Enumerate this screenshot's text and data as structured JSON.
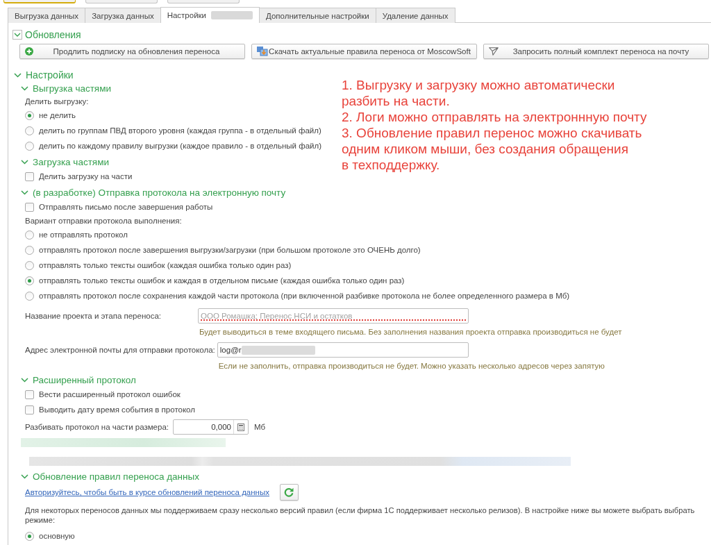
{
  "toolbar_edges": [
    {
      "kind": "accent"
    },
    {
      "kind": "plain"
    },
    {
      "kind": "plain"
    }
  ],
  "tabs": [
    {
      "label": "Выгрузка данных",
      "selected": false,
      "redacted_suffix": false
    },
    {
      "label": "Загрузка данных",
      "selected": false,
      "redacted_suffix": false
    },
    {
      "label": "Настройки",
      "selected": true,
      "redacted_suffix": true
    },
    {
      "label": "Дополнительные настройки",
      "selected": false,
      "redacted_suffix": false
    },
    {
      "label": "Удаление данных",
      "selected": false,
      "redacted_suffix": false
    }
  ],
  "updates_group": {
    "title": "Обновления",
    "expanded": true,
    "buttons": [
      {
        "label": "Продлить подписку на обновления переноса"
      },
      {
        "label": "Скачать актуальные правила переноса от MoscowSoft"
      },
      {
        "label": "Запросить полный комплект переноса на почту"
      }
    ]
  },
  "settings_group": {
    "title": "Настройки",
    "expanded": true,
    "sections": [
      {
        "title": "Выгрузка частями",
        "expanded": true,
        "items": [
          {
            "kind": "radios",
            "label": "Делить выгрузку:",
            "options": [
              {
                "label": "не делить",
                "selected": true
              },
              {
                "label": "делить по группам ПВД второго уровня (каждая группа - в отдельный файл)",
                "selected": false
              },
              {
                "label": "делить по каждому правилу выгрузки (каждое правило - в отдельный файл)",
                "selected": false
              }
            ]
          }
        ]
      },
      {
        "title": "Загрузка частями",
        "expanded": true,
        "items": [
          {
            "kind": "checkbox",
            "label": "Делить загрузку на части",
            "checked": false
          }
        ]
      },
      {
        "title": "(в разработке) Отправка протокола на электронную почту",
        "expanded": true,
        "items": [
          {
            "kind": "checkbox",
            "label": "Отправлять письмо после завершения работы",
            "checked": false
          },
          {
            "kind": "radios",
            "label": "Вариант отправки протокола выполнения:",
            "options": [
              {
                "label": "не отправлять протокол",
                "selected": false
              },
              {
                "label": "отправлять протокол после завершения выгрузки/загрузки (при большом протоколе это ОЧЕНЬ долго)",
                "selected": false
              },
              {
                "label": "отправлять только тексты ошибок (каждая ошибка только один раз)",
                "selected": false
              },
              {
                "label": "отправлять только тексты ошибок и каждая в отдельном письме (каждая ошибка только один раз)",
                "selected": true
              },
              {
                "label": "отправлять протокол после сохранения каждой части протокола (при включенной разбивке протокола не более определенного размера в Мб)",
                "selected": false
              }
            ]
          },
          {
            "kind": "textfield",
            "label": "Название проекта и этапа переноса:",
            "placeholder": "ООО Ромашка; Перенос НСИ и остатков",
            "required": true,
            "redacted_suffix": false,
            "hint": "Будет выводиться в теме входящего письма. Без заполнения названия проекта отправка производиться не будет"
          },
          {
            "kind": "textfield",
            "label": "Адрес электронной почты для отправки протокола:",
            "value": "log@r",
            "required": false,
            "redacted_suffix": true,
            "hint": "Если не заполнить, отправка производиться не будет. Можно указать несколько адресов через запятую"
          }
        ]
      },
      {
        "title": "Расширенный протокол",
        "expanded": true,
        "items": [
          {
            "kind": "checkbox",
            "label": "Вести расширенный протокол ошибок",
            "checked": false
          },
          {
            "kind": "checkbox",
            "label": "Выводить дату время события в протокол",
            "checked": false
          },
          {
            "kind": "numberfield",
            "label": "Разбивать протокол на части размера:",
            "value": "0,000",
            "unit": "Мб"
          },
          {
            "kind": "redacted",
            "heading": true
          },
          {
            "kind": "redacted",
            "heading": false
          }
        ]
      },
      {
        "title": "Обновление правил переноса данных",
        "expanded": true,
        "items": [
          {
            "kind": "link",
            "label": "Авторизуйтесь, чтобы быть в курсе обновлений переноса данных"
          },
          {
            "kind": "paragraph",
            "text": "Для некоторых переносов данных мы поддерживаем сразу несколько версий правил (если фирма 1С поддерживает несколько релизов). В настройке ниже вы можете выбрать выбрать\nрежиме:"
          },
          {
            "kind": "radios",
            "options": [
              {
                "label": "основную",
                "selected": true
              }
            ]
          }
        ]
      }
    ]
  },
  "annotation": {
    "paragraphs": [
      "1. Выгрузку и загрузку можно автоматически\nразбить на части.",
      "2. Логи можно отправлять на электроннную почту",
      "3. Обновление правил перенос можно скачивать\nодним кликом мыши, без создания обращения\nв техподдержку."
    ]
  }
}
